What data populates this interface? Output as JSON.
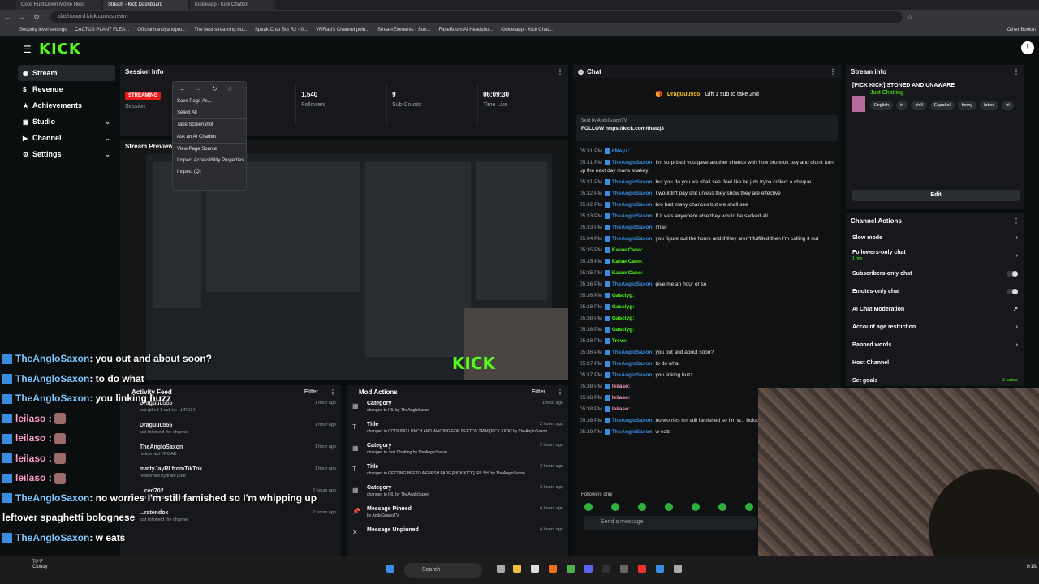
{
  "browser": {
    "tabs": [
      "Cops Hunt Down Movie Heist",
      "Stream - Kick Dashboard",
      "KickleApp - Kick Chatbot",
      ""
    ],
    "url": "dashboard.kick.com/stream",
    "bookmarks": [
      "Security level settings",
      "CACTUS PLANT FLEA...",
      "Official handyandpro...",
      "The best streaming bo...",
      "Speak Chat Bot R2 - 0...",
      "VRFlad's Channel poin...",
      "StreamElements - Son...",
      "FaceBoom AI Headsho...",
      "Kickletapp - Kick Chat...",
      "Other Bookm"
    ]
  },
  "header": {
    "logo": "KICK"
  },
  "sidebar": {
    "items": [
      {
        "label": "Stream",
        "icon": "broadcast-icon",
        "active": true
      },
      {
        "label": "Revenue",
        "icon": "dollar-icon"
      },
      {
        "label": "Achievements",
        "icon": "star-icon"
      },
      {
        "label": "Studio",
        "icon": "studio-icon",
        "expandable": true
      },
      {
        "label": "Channel",
        "icon": "channel-icon",
        "expandable": true
      },
      {
        "label": "Settings",
        "icon": "gear-icon",
        "expandable": true
      }
    ]
  },
  "session": {
    "title": "Session Info",
    "status": "STREAMING",
    "session_label": "Session",
    "stats": [
      {
        "value": "1,540",
        "label": "Followers"
      },
      {
        "value": "9",
        "label": "Sub Counts"
      },
      {
        "value": "06:09:30",
        "label": "Time Live"
      }
    ]
  },
  "context_menu": {
    "items": [
      "Save Page As...",
      "Select All",
      "Take Screenshot",
      "Ask an AI Chatbot",
      "View Page Source",
      "Inspect Accessibility Properties",
      "Inspect (Q)"
    ]
  },
  "preview": {
    "title": "Stream Preview",
    "watermark": "KICK"
  },
  "activity": {
    "title": "Activity Feed",
    "filter": "Filter",
    "rows": [
      {
        "name": "Draguuu555",
        "sub": "just gifted 1 sub to: LURK24",
        "time": "1 hour ago"
      },
      {
        "name": "Draguuu555",
        "sub": "just followed the channel",
        "time": "1 hour ago"
      },
      {
        "name": "TheAngloSaxon",
        "sub": "redeemed YROAE",
        "time": "1 hour ago"
      },
      {
        "name": "mattyJayRLfromTikTok",
        "sub": "redeemed hydrate pute",
        "time": "1 hour ago"
      },
      {
        "name": "...ced702",
        "sub": "just followed the channel",
        "time": "2 hours ago"
      },
      {
        "name": "...ratendox",
        "sub": "just followed the channel",
        "time": "2 hours ago"
      }
    ]
  },
  "mod_actions": {
    "title": "Mod Actions",
    "filter": "Filter",
    "rows": [
      {
        "name": "Category",
        "sub": "changed to IRL by TheAngloSaxon",
        "time": "1 hour ago"
      },
      {
        "name": "Title",
        "sub": "changed to COOKING LUNCH AND WAITING FOR BEETOS TRIM [PICK KICK] by TheAngloSaxon",
        "time": "2 hours ago"
      },
      {
        "name": "Category",
        "sub": "changed to Just Chatting by TheAngloSaxon",
        "time": "2 hours ago"
      },
      {
        "name": "Title",
        "sub": "changed to GETTING BEETO A FRESH FADE [PICK KICK] IRL SHI by TheAngloSaxon",
        "time": "3 hours ago"
      },
      {
        "name": "Category",
        "sub": "changed to IRL by TheAngloSaxon",
        "time": "3 hours ago"
      },
      {
        "name": "Message Pinned",
        "sub": "by AndeGuapoTV",
        "time": "4 hours ago"
      },
      {
        "name": "Message Unpinned",
        "sub": "",
        "time": "4 hours ago"
      }
    ]
  },
  "chat": {
    "title": "Chat",
    "gift_user": "Draguuu555",
    "gift_text": "Gift 1 sub to take 2nd",
    "pinned_sender": "Sent by AndeGuapoTV",
    "pinned_text": "FOLLOW https://kick.com/thatzj3",
    "messages": [
      {
        "t": "05:31 PM",
        "n": "6Meyz:",
        "m": "",
        "c": "#3a8dde"
      },
      {
        "t": "05:31 PM",
        "n": "TheAngloSaxon:",
        "m": "I'm surprised you gave another chance with how bro took pay and didn't turn up the next day mans snakey",
        "c": "#3a8dde"
      },
      {
        "t": "05:31 PM",
        "n": "TheAngloSaxon:",
        "m": "but you do you we shall see. feel like he juts tryna collect a cheque",
        "c": "#3a8dde"
      },
      {
        "t": "05:32 PM",
        "n": "TheAngloSaxon:",
        "m": "I wouldn't pay shit unless they show they are effective",
        "c": "#3a8dde"
      },
      {
        "t": "05:32 PM",
        "n": "TheAngloSaxon:",
        "m": "bro had many chances but we shall see",
        "c": "#3a8dde"
      },
      {
        "t": "05:33 PM",
        "n": "TheAngloSaxon:",
        "m": "If it was anywhere else they would be sacked all",
        "c": "#3a8dde"
      },
      {
        "t": "05:33 PM",
        "n": "TheAngloSaxon:",
        "m": "lmao",
        "c": "#3a8dde"
      },
      {
        "t": "05:34 PM",
        "n": "TheAngloSaxon:",
        "m": "you figure out the hours and if they aren't fulfilled then I'm calling it out",
        "c": "#3a8dde"
      },
      {
        "t": "05:35 PM",
        "n": "KaiserCano:",
        "m": "",
        "c": "#53fc18"
      },
      {
        "t": "05:35 PM",
        "n": "KaiserCano:",
        "m": "",
        "c": "#53fc18"
      },
      {
        "t": "05:35 PM",
        "n": "KaiserCano:",
        "m": "",
        "c": "#53fc18"
      },
      {
        "t": "05:36 PM",
        "n": "TheAngloSaxon:",
        "m": "give me an hour or so",
        "c": "#3a8dde"
      },
      {
        "t": "05:36 PM",
        "n": "Gasclyg:",
        "m": "",
        "c": "#53fc18"
      },
      {
        "t": "05:38 PM",
        "n": "Gasclyg:",
        "m": "",
        "c": "#53fc18"
      },
      {
        "t": "05:38 PM",
        "n": "Gasclyg:",
        "m": "",
        "c": "#53fc18"
      },
      {
        "t": "05:38 PM",
        "n": "Gasclyg:",
        "m": "",
        "c": "#53fc18"
      },
      {
        "t": "05:38 PM",
        "n": "Trevv:",
        "m": "",
        "c": "#53fc18"
      },
      {
        "t": "05:36 PM",
        "n": "TheAngloSaxon:",
        "m": "you out and about soon?",
        "c": "#3a8dde"
      },
      {
        "t": "05:37 PM",
        "n": "TheAngloSaxon:",
        "m": "to do what",
        "c": "#3a8dde"
      },
      {
        "t": "05:37 PM",
        "n": "TheAngloSaxon:",
        "m": "you linking huzz",
        "c": "#3a8dde"
      },
      {
        "t": "05:38 PM",
        "n": "leilaso:",
        "m": "",
        "c": "#ff9ec8"
      },
      {
        "t": "05:38 PM",
        "n": "leilaso:",
        "m": "",
        "c": "#ff9ec8"
      },
      {
        "t": "05:38 PM",
        "n": "leilaso:",
        "m": "",
        "c": "#ff9ec8"
      },
      {
        "t": "05:38 PM",
        "n": "TheAngloSaxon:",
        "m": "no worries I'm still famished so I'm w... bolognese",
        "c": "#3a8dde"
      },
      {
        "t": "05:39 PM",
        "n": "TheAngloSaxon:",
        "m": "w eats",
        "c": "#3a8dde"
      }
    ],
    "followers_only": "Followers only",
    "input_placeholder": "Send a message"
  },
  "stream_info": {
    "title": "Stream info",
    "stream_title": "[PICK KICK] STONED AND UNAWARE",
    "category": "Just Chatting",
    "tags": [
      "English",
      "irl",
      "chill",
      "Español",
      "funny",
      "latino",
      "irl"
    ],
    "edit_label": "Edit"
  },
  "channel_actions": {
    "title": "Channel Actions",
    "rows": [
      {
        "label": "Slow mode",
        "kind": "arrow"
      },
      {
        "label": "Followers-only chat",
        "kind": "arrow",
        "note": "1 min"
      },
      {
        "label": "Subscribers-only chat",
        "kind": "toggle"
      },
      {
        "label": "Emotes-only chat",
        "kind": "toggle"
      },
      {
        "label": "AI Chat Moderation",
        "kind": "external"
      },
      {
        "label": "Account age restriction",
        "kind": "arrow"
      },
      {
        "label": "Banned words",
        "kind": "arrow"
      },
      {
        "label": "Host Channel",
        "kind": "none"
      },
      {
        "label": "Set goals",
        "kind": "badge",
        "note": "2 active"
      }
    ]
  },
  "overlay": {
    "lines": [
      {
        "name": "TheAngloSaxon",
        "msg": ": you out and about soon?",
        "emote": false
      },
      {
        "name": "TheAngloSaxon",
        "msg": ": to do what",
        "emote": false
      },
      {
        "name": "TheAngloSaxon",
        "msg": ": you linking huzz",
        "emote": false
      },
      {
        "name": "leilaso",
        "msg": " :",
        "emote": true
      },
      {
        "name": "leilaso",
        "msg": " :",
        "emote": true
      },
      {
        "name": "leilaso",
        "msg": " :",
        "emote": true
      },
      {
        "name": "leilaso",
        "msg": " :",
        "emote": true
      },
      {
        "name": "TheAngloSaxon",
        "msg": ": no worries I'm still famished so I'm whipping up",
        "emote": false
      },
      {
        "name": "",
        "msg": "leftover spaghetti bolognese",
        "emote": false
      },
      {
        "name": "TheAngloSaxon",
        "msg": ": w eats",
        "emote": false
      }
    ]
  },
  "taskbar": {
    "weather_temp": "70°F",
    "weather_desc": "Cloudy",
    "search": "Search",
    "date": "9/18/"
  }
}
